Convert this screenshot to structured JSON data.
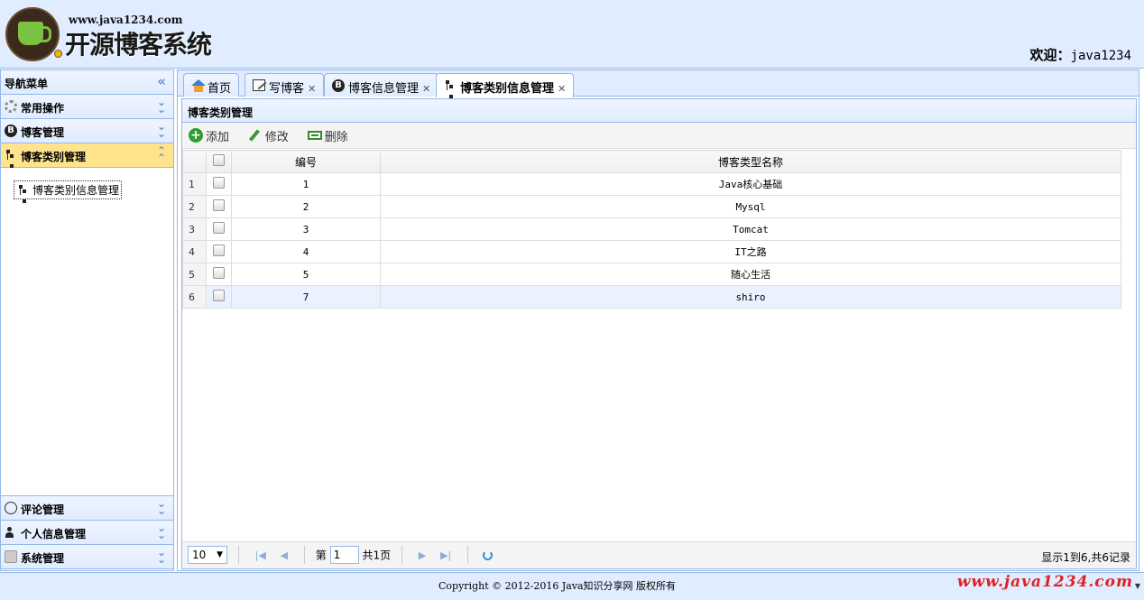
{
  "header": {
    "site_url": "www.java1234.com",
    "system_title": "开源博客系统",
    "welcome_label": "欢迎：",
    "username": "java1234"
  },
  "nav": {
    "title": "导航菜单",
    "collapse_icon": "double-chevron-left-icon",
    "sections": [
      {
        "label": "常用操作",
        "icon": "gear-icon"
      },
      {
        "label": "博客管理",
        "icon": "blogger-icon"
      },
      {
        "label": "博客类别管理",
        "icon": "tree-icon",
        "selected": true,
        "items": [
          {
            "label": "博客类别信息管理"
          }
        ]
      },
      {
        "label": "评论管理",
        "icon": "comment-icon"
      },
      {
        "label": "个人信息管理",
        "icon": "user-icon"
      },
      {
        "label": "系统管理",
        "icon": "system-icon"
      }
    ]
  },
  "tabs": [
    {
      "label": "首页",
      "icon": "home-icon",
      "closable": false
    },
    {
      "label": "写博客",
      "icon": "edit-icon",
      "closable": true
    },
    {
      "label": "博客信息管理",
      "icon": "blogger-icon",
      "closable": true
    },
    {
      "label": "博客类别信息管理",
      "icon": "tree-icon",
      "closable": true,
      "active": true
    }
  ],
  "panel": {
    "title": "博客类别管理",
    "toolbar": {
      "add": "添加",
      "edit": "修改",
      "delete": "删除"
    },
    "columns": [
      "编号",
      "博客类型名称"
    ],
    "rows": [
      {
        "rownum": "1",
        "id": "1",
        "name": "Java核心基础"
      },
      {
        "rownum": "2",
        "id": "2",
        "name": "Mysql"
      },
      {
        "rownum": "3",
        "id": "3",
        "name": "Tomcat"
      },
      {
        "rownum": "4",
        "id": "4",
        "name": "IT之路"
      },
      {
        "rownum": "5",
        "id": "5",
        "name": "随心生活"
      },
      {
        "rownum": "6",
        "id": "7",
        "name": "shiro"
      }
    ],
    "pager": {
      "page_size": "10",
      "page_label": "第",
      "page_number": "1",
      "total_pages": "共1页",
      "info": "显示1到6,共6记录"
    }
  },
  "footer": {
    "copyright": "Copyright © 2012-2016 Java知识分享网 版权所有",
    "watermark": "www.java1234.com"
  }
}
